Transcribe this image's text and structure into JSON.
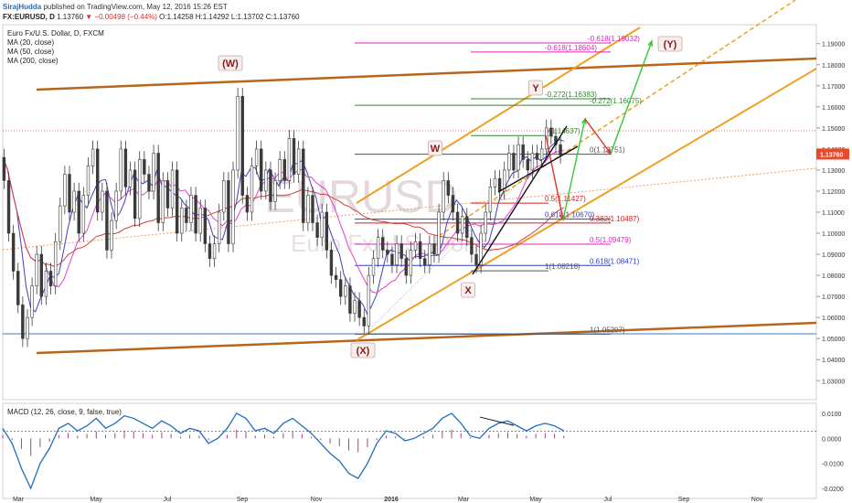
{
  "header": {
    "author": "SirajHudda",
    "published": "published on TradingView.com, May 12, 2016 15:26 EST",
    "symbol": "FX:EURUSD, D",
    "last": "1.13760",
    "change": "▼ −0.00498 (−0.44%)",
    "ohlc": "O:1.14258 H:1.14292 L:1.13702 C:1.13760"
  },
  "legend": {
    "title": "Euro Fx/U.S. Dollar, D, FXCM",
    "ma20": "MA (20, close)",
    "ma50": "MA (50, close)",
    "ma200": "MA (200, close)",
    "macd": "MACD (12, 26, close, 9, false, true)"
  },
  "watermark": {
    "symbol": "EURUSD",
    "name": "Euro Fx/U.S. Dollar"
  },
  "colors": {
    "price_up": "#4caf50",
    "price_down": "#e03b3b",
    "candles": "#555555",
    "ma20": "#3f3fbf",
    "ma50": "#e040d0",
    "ma200": "#d04040",
    "channel_outer": "#b8651b",
    "channel_inner": "#f0a020",
    "fib_magenta": "#e020c0",
    "fib_green": "#2e8b2e",
    "fib_blue": "#3040c0",
    "fib_red": "#d02020",
    "wave_label": "#8b1a1a",
    "macd_line": "#1e6fbf",
    "macd_hist": "#9b4a7a",
    "price_tag": "#e8492b"
  },
  "chart_data": {
    "type": "line",
    "title": "Euro Fx/U.S. Dollar, D, FXCM",
    "x_ticks": [
      "Mar",
      "May",
      "Jul",
      "Sep",
      "Nov",
      "2016",
      "Mar",
      "May",
      "Jul",
      "Sep",
      "Nov"
    ],
    "y_ticks": [
      "1.19000",
      "1.18000",
      "1.17000",
      "1.16000",
      "1.15000",
      "1.14000",
      "1.13000",
      "1.12000",
      "1.11000",
      "1.10000",
      "1.09000",
      "1.08000",
      "1.07000",
      "1.06000",
      "1.05000",
      "1.04000",
      "1.03000"
    ],
    "ylim": [
      1.021,
      1.199
    ],
    "last_price_label": "1.13760",
    "price_series": {
      "name": "EURUSD",
      "points": [
        [
          0,
          1.136
        ],
        [
          5,
          1.125
        ],
        [
          10,
          1.1
        ],
        [
          15,
          1.082
        ],
        [
          20,
          1.066
        ],
        [
          25,
          1.05
        ],
        [
          30,
          1.06
        ],
        [
          35,
          1.075
        ],
        [
          40,
          1.09
        ],
        [
          45,
          1.07
        ],
        [
          50,
          1.082
        ],
        [
          55,
          1.075
        ],
        [
          60,
          1.096
        ],
        [
          65,
          1.113
        ],
        [
          70,
          1.128
        ],
        [
          75,
          1.11
        ],
        [
          80,
          1.12
        ],
        [
          85,
          1.1
        ],
        [
          90,
          1.118
        ],
        [
          95,
          1.132
        ],
        [
          100,
          1.14
        ],
        [
          105,
          1.11
        ],
        [
          110,
          1.12
        ],
        [
          115,
          1.092
        ],
        [
          120,
          1.106
        ],
        [
          125,
          1.12
        ],
        [
          130,
          1.14
        ],
        [
          135,
          1.122
        ],
        [
          140,
          1.13
        ],
        [
          145,
          1.107
        ],
        [
          150,
          1.135
        ],
        [
          155,
          1.128
        ],
        [
          160,
          1.12
        ],
        [
          165,
          1.138
        ],
        [
          170,
          1.105
        ],
        [
          175,
          1.125
        ],
        [
          180,
          1.112
        ],
        [
          185,
          1.13
        ],
        [
          190,
          1.1
        ],
        [
          195,
          1.112
        ],
        [
          200,
          1.105
        ],
        [
          205,
          1.118
        ],
        [
          210,
          1.1
        ],
        [
          215,
          1.112
        ],
        [
          220,
          1.095
        ],
        [
          225,
          1.088
        ],
        [
          230,
          1.095
        ],
        [
          235,
          1.11
        ],
        [
          240,
          1.125
        ],
        [
          245,
          1.095
        ],
        [
          250,
          1.13
        ],
        [
          255,
          1.165
        ],
        [
          260,
          1.118
        ],
        [
          265,
          1.11
        ],
        [
          270,
          1.132
        ],
        [
          275,
          1.14
        ],
        [
          280,
          1.12
        ],
        [
          285,
          1.13
        ],
        [
          290,
          1.115
        ],
        [
          295,
          1.125
        ],
        [
          300,
          1.135
        ],
        [
          305,
          1.125
        ],
        [
          310,
          1.145
        ],
        [
          315,
          1.128
        ],
        [
          320,
          1.14
        ],
        [
          325,
          1.105
        ],
        [
          330,
          1.118
        ],
        [
          335,
          1.105
        ],
        [
          340,
          1.098
        ],
        [
          345,
          1.11
        ],
        [
          350,
          1.092
        ],
        [
          355,
          1.08
        ],
        [
          360,
          1.078
        ],
        [
          365,
          1.07
        ],
        [
          370,
          1.075
        ],
        [
          375,
          1.062
        ],
        [
          380,
          1.068
        ],
        [
          385,
          1.06
        ],
        [
          390,
          1.056
        ],
        [
          395,
          1.08
        ],
        [
          400,
          1.088
        ],
        [
          405,
          1.098
        ],
        [
          410,
          1.092
        ],
        [
          415,
          1.09
        ],
        [
          420,
          1.085
        ],
        [
          425,
          1.095
        ],
        [
          430,
          1.088
        ],
        [
          435,
          1.08
        ],
        [
          440,
          1.092
        ],
        [
          445,
          1.096
        ],
        [
          450,
          1.088
        ],
        [
          455,
          1.085
        ],
        [
          460,
          1.095
        ],
        [
          465,
          1.09
        ],
        [
          470,
          1.11
        ],
        [
          475,
          1.125
        ],
        [
          480,
          1.118
        ],
        [
          485,
          1.11
        ],
        [
          490,
          1.1
        ],
        [
          495,
          1.108
        ],
        [
          500,
          1.098
        ],
        [
          505,
          1.09
        ],
        [
          510,
          1.085
        ],
        [
          515,
          1.1
        ],
        [
          520,
          1.11
        ],
        [
          525,
          1.122
        ],
        [
          530,
          1.126
        ],
        [
          535,
          1.12
        ],
        [
          540,
          1.13
        ],
        [
          545,
          1.138
        ],
        [
          550,
          1.13
        ],
        [
          555,
          1.142
        ],
        [
          560,
          1.135
        ],
        [
          565,
          1.13
        ],
        [
          570,
          1.138
        ],
        [
          575,
          1.135
        ],
        [
          580,
          1.14
        ],
        [
          585,
          1.15
        ],
        [
          590,
          1.146
        ],
        [
          595,
          1.142
        ],
        [
          600,
          1.137
        ]
      ]
    },
    "fib_levels": [
      {
        "label": "-0.618(1.19032)",
        "value": 1.19032,
        "color": "#e020c0"
      },
      {
        "label": "-0.618(1.18604)",
        "value": 1.18604,
        "color": "#e020c0"
      },
      {
        "label": "-0.272(1.16383)",
        "value": 1.16383,
        "color": "#2e8b2e"
      },
      {
        "label": "-0.272(1.16075)",
        "value": 1.16075,
        "color": "#2e8b2e"
      },
      {
        "label": "0(1.14637)",
        "value": 1.14637,
        "color": "#2e8b2e"
      },
      {
        "label": "0(1.13751)",
        "value": 1.13751,
        "color": "#555555"
      },
      {
        "label": "0.5(1.11427)",
        "value": 1.11427,
        "color": "#d02020"
      },
      {
        "label": "0.618(1.10670)",
        "value": 1.1067,
        "color": "#3040c0"
      },
      {
        "label": "0.382(1.10487)",
        "value": 1.10487,
        "color": "#d02020"
      },
      {
        "label": "0.5(1.09479)",
        "value": 1.09479,
        "color": "#e020c0"
      },
      {
        "label": "0.618(1.08471)",
        "value": 1.08471,
        "color": "#3040c0"
      },
      {
        "label": "1(1.08218)",
        "value": 1.08218,
        "color": "#555555"
      },
      {
        "label": "1(1.05207)",
        "value": 1.05207,
        "color": "#555555"
      }
    ],
    "wave_labels": [
      "(W)",
      "W",
      "Y",
      "X",
      "(X)",
      "(Y)"
    ],
    "macd": {
      "y_ticks": [
        "0.0100",
        "0.0000",
        "-0.0100",
        "-0.0200"
      ],
      "ylim": [
        -0.024,
        0.014
      ],
      "signal_level": 0.0028,
      "line": [
        [
          0,
          0.004
        ],
        [
          10,
          -0.002
        ],
        [
          20,
          -0.012
        ],
        [
          30,
          -0.02
        ],
        [
          40,
          -0.01
        ],
        [
          50,
          -0.004
        ],
        [
          60,
          0.004
        ],
        [
          70,
          0.006
        ],
        [
          80,
          0.003
        ],
        [
          90,
          0.005
        ],
        [
          100,
          0.008
        ],
        [
          110,
          0.004
        ],
        [
          120,
          0.006
        ],
        [
          130,
          0.009
        ],
        [
          140,
          0.008
        ],
        [
          150,
          0.006
        ],
        [
          160,
          0.004
        ],
        [
          170,
          0.007
        ],
        [
          180,
          0.005
        ],
        [
          190,
          0.002
        ],
        [
          200,
          0.004
        ],
        [
          210,
          0.003
        ],
        [
          220,
          -0.002
        ],
        [
          230,
          0.0
        ],
        [
          240,
          0.004
        ],
        [
          250,
          0.01
        ],
        [
          260,
          0.008
        ],
        [
          270,
          0.003
        ],
        [
          280,
          0.004
        ],
        [
          290,
          0.002
        ],
        [
          300,
          0.006
        ],
        [
          310,
          0.008
        ],
        [
          320,
          0.005
        ],
        [
          330,
          0.002
        ],
        [
          340,
          -0.002
        ],
        [
          350,
          -0.006
        ],
        [
          360,
          -0.009
        ],
        [
          370,
          -0.014
        ],
        [
          380,
          -0.016
        ],
        [
          390,
          -0.01
        ],
        [
          400,
          -0.002
        ],
        [
          410,
          0.003
        ],
        [
          420,
          0.002
        ],
        [
          430,
          -0.001
        ],
        [
          440,
          0.0
        ],
        [
          450,
          0.002
        ],
        [
          460,
          0.004
        ],
        [
          470,
          0.008
        ],
        [
          480,
          0.01
        ],
        [
          490,
          0.006
        ],
        [
          500,
          0.001
        ],
        [
          510,
          0.0
        ],
        [
          520,
          0.004
        ],
        [
          530,
          0.006
        ],
        [
          540,
          0.007
        ],
        [
          550,
          0.005
        ],
        [
          560,
          0.003
        ],
        [
          570,
          0.005
        ],
        [
          580,
          0.006
        ],
        [
          590,
          0.005
        ],
        [
          600,
          0.003
        ]
      ]
    }
  }
}
